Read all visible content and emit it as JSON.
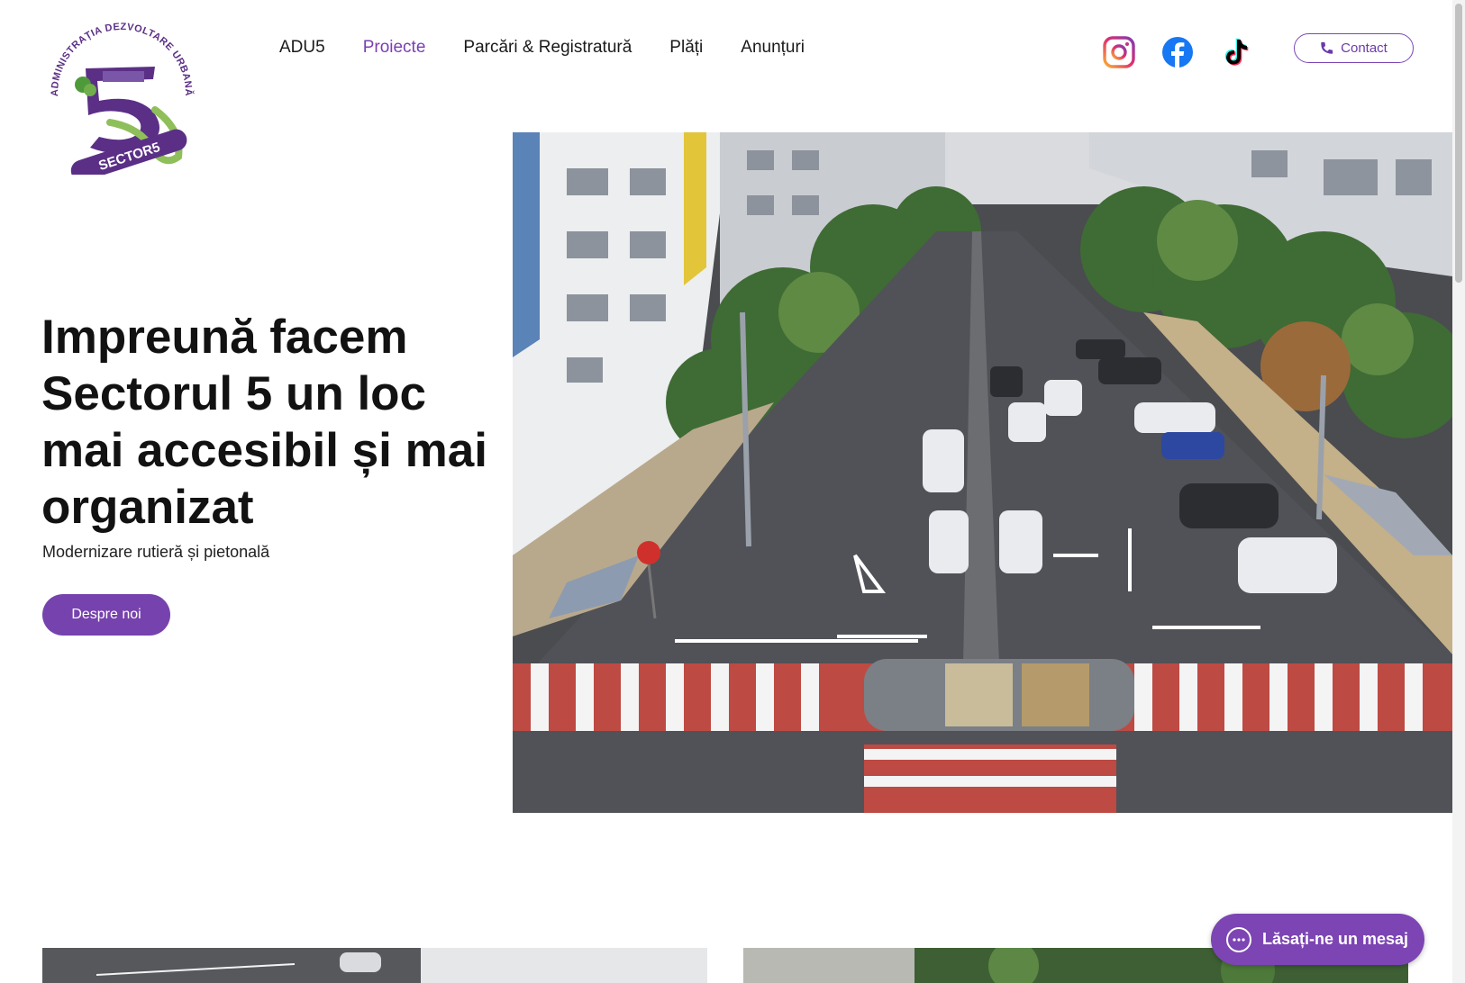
{
  "logo": {
    "text_arc": "ADMINISTRAȚIA DEZVOLTARE URBANĂ",
    "text_badge": "SECTOR5",
    "colors": {
      "purple": "#5b2f86",
      "green": "#4e9a3a"
    }
  },
  "nav": {
    "items": [
      {
        "label": "ADU5",
        "active": false
      },
      {
        "label": "Proiecte",
        "active": true
      },
      {
        "label": "Parcări & Registratură",
        "active": false
      },
      {
        "label": "Plăți",
        "active": false
      },
      {
        "label": "Anunțuri",
        "active": false
      }
    ]
  },
  "social": {
    "icons": [
      "instagram-icon",
      "facebook-icon",
      "tiktok-icon"
    ]
  },
  "contact": {
    "label": "Contact",
    "icon": "phone-icon"
  },
  "hero": {
    "headline": "Impreună facem Sectorul 5 un loc mai accesibil și mai organizat",
    "subtitle": "Modernizare rutieră și pietonală",
    "button_label": "Despre noi"
  },
  "chat": {
    "label": "Lăsați-ne un mesaj",
    "icon": "chat-bubble-icon"
  },
  "colors": {
    "accent": "#7642ad",
    "text": "#121212"
  }
}
